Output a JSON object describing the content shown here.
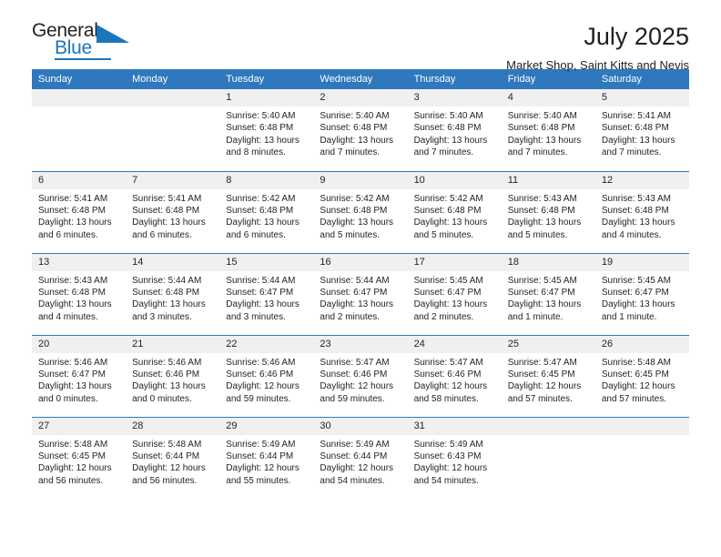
{
  "brand": {
    "name_part1": "General",
    "name_part2": "Blue",
    "accent_color": "#1b75bb"
  },
  "header": {
    "title": "July 2025",
    "subtitle": "Market Shop, Saint Kitts and Nevis"
  },
  "colors": {
    "header_blue": "#2f78bd",
    "daynum_band": "#f0f0f0",
    "text": "#231f20"
  },
  "weekdays": [
    "Sunday",
    "Monday",
    "Tuesday",
    "Wednesday",
    "Thursday",
    "Friday",
    "Saturday"
  ],
  "weeks": [
    [
      {
        "day": "",
        "sunrise": "",
        "sunset": "",
        "daylight": ""
      },
      {
        "day": "",
        "sunrise": "",
        "sunset": "",
        "daylight": ""
      },
      {
        "day": "1",
        "sunrise": "Sunrise: 5:40 AM",
        "sunset": "Sunset: 6:48 PM",
        "daylight": "Daylight: 13 hours and 8 minutes."
      },
      {
        "day": "2",
        "sunrise": "Sunrise: 5:40 AM",
        "sunset": "Sunset: 6:48 PM",
        "daylight": "Daylight: 13 hours and 7 minutes."
      },
      {
        "day": "3",
        "sunrise": "Sunrise: 5:40 AM",
        "sunset": "Sunset: 6:48 PM",
        "daylight": "Daylight: 13 hours and 7 minutes."
      },
      {
        "day": "4",
        "sunrise": "Sunrise: 5:40 AM",
        "sunset": "Sunset: 6:48 PM",
        "daylight": "Daylight: 13 hours and 7 minutes."
      },
      {
        "day": "5",
        "sunrise": "Sunrise: 5:41 AM",
        "sunset": "Sunset: 6:48 PM",
        "daylight": "Daylight: 13 hours and 7 minutes."
      }
    ],
    [
      {
        "day": "6",
        "sunrise": "Sunrise: 5:41 AM",
        "sunset": "Sunset: 6:48 PM",
        "daylight": "Daylight: 13 hours and 6 minutes."
      },
      {
        "day": "7",
        "sunrise": "Sunrise: 5:41 AM",
        "sunset": "Sunset: 6:48 PM",
        "daylight": "Daylight: 13 hours and 6 minutes."
      },
      {
        "day": "8",
        "sunrise": "Sunrise: 5:42 AM",
        "sunset": "Sunset: 6:48 PM",
        "daylight": "Daylight: 13 hours and 6 minutes."
      },
      {
        "day": "9",
        "sunrise": "Sunrise: 5:42 AM",
        "sunset": "Sunset: 6:48 PM",
        "daylight": "Daylight: 13 hours and 5 minutes."
      },
      {
        "day": "10",
        "sunrise": "Sunrise: 5:42 AM",
        "sunset": "Sunset: 6:48 PM",
        "daylight": "Daylight: 13 hours and 5 minutes."
      },
      {
        "day": "11",
        "sunrise": "Sunrise: 5:43 AM",
        "sunset": "Sunset: 6:48 PM",
        "daylight": "Daylight: 13 hours and 5 minutes."
      },
      {
        "day": "12",
        "sunrise": "Sunrise: 5:43 AM",
        "sunset": "Sunset: 6:48 PM",
        "daylight": "Daylight: 13 hours and 4 minutes."
      }
    ],
    [
      {
        "day": "13",
        "sunrise": "Sunrise: 5:43 AM",
        "sunset": "Sunset: 6:48 PM",
        "daylight": "Daylight: 13 hours and 4 minutes."
      },
      {
        "day": "14",
        "sunrise": "Sunrise: 5:44 AM",
        "sunset": "Sunset: 6:48 PM",
        "daylight": "Daylight: 13 hours and 3 minutes."
      },
      {
        "day": "15",
        "sunrise": "Sunrise: 5:44 AM",
        "sunset": "Sunset: 6:47 PM",
        "daylight": "Daylight: 13 hours and 3 minutes."
      },
      {
        "day": "16",
        "sunrise": "Sunrise: 5:44 AM",
        "sunset": "Sunset: 6:47 PM",
        "daylight": "Daylight: 13 hours and 2 minutes."
      },
      {
        "day": "17",
        "sunrise": "Sunrise: 5:45 AM",
        "sunset": "Sunset: 6:47 PM",
        "daylight": "Daylight: 13 hours and 2 minutes."
      },
      {
        "day": "18",
        "sunrise": "Sunrise: 5:45 AM",
        "sunset": "Sunset: 6:47 PM",
        "daylight": "Daylight: 13 hours and 1 minute."
      },
      {
        "day": "19",
        "sunrise": "Sunrise: 5:45 AM",
        "sunset": "Sunset: 6:47 PM",
        "daylight": "Daylight: 13 hours and 1 minute."
      }
    ],
    [
      {
        "day": "20",
        "sunrise": "Sunrise: 5:46 AM",
        "sunset": "Sunset: 6:47 PM",
        "daylight": "Daylight: 13 hours and 0 minutes."
      },
      {
        "day": "21",
        "sunrise": "Sunrise: 5:46 AM",
        "sunset": "Sunset: 6:46 PM",
        "daylight": "Daylight: 13 hours and 0 minutes."
      },
      {
        "day": "22",
        "sunrise": "Sunrise: 5:46 AM",
        "sunset": "Sunset: 6:46 PM",
        "daylight": "Daylight: 12 hours and 59 minutes."
      },
      {
        "day": "23",
        "sunrise": "Sunrise: 5:47 AM",
        "sunset": "Sunset: 6:46 PM",
        "daylight": "Daylight: 12 hours and 59 minutes."
      },
      {
        "day": "24",
        "sunrise": "Sunrise: 5:47 AM",
        "sunset": "Sunset: 6:46 PM",
        "daylight": "Daylight: 12 hours and 58 minutes."
      },
      {
        "day": "25",
        "sunrise": "Sunrise: 5:47 AM",
        "sunset": "Sunset: 6:45 PM",
        "daylight": "Daylight: 12 hours and 57 minutes."
      },
      {
        "day": "26",
        "sunrise": "Sunrise: 5:48 AM",
        "sunset": "Sunset: 6:45 PM",
        "daylight": "Daylight: 12 hours and 57 minutes."
      }
    ],
    [
      {
        "day": "27",
        "sunrise": "Sunrise: 5:48 AM",
        "sunset": "Sunset: 6:45 PM",
        "daylight": "Daylight: 12 hours and 56 minutes."
      },
      {
        "day": "28",
        "sunrise": "Sunrise: 5:48 AM",
        "sunset": "Sunset: 6:44 PM",
        "daylight": "Daylight: 12 hours and 56 minutes."
      },
      {
        "day": "29",
        "sunrise": "Sunrise: 5:49 AM",
        "sunset": "Sunset: 6:44 PM",
        "daylight": "Daylight: 12 hours and 55 minutes."
      },
      {
        "day": "30",
        "sunrise": "Sunrise: 5:49 AM",
        "sunset": "Sunset: 6:44 PM",
        "daylight": "Daylight: 12 hours and 54 minutes."
      },
      {
        "day": "31",
        "sunrise": "Sunrise: 5:49 AM",
        "sunset": "Sunset: 6:43 PM",
        "daylight": "Daylight: 12 hours and 54 minutes."
      },
      {
        "day": "",
        "sunrise": "",
        "sunset": "",
        "daylight": ""
      },
      {
        "day": "",
        "sunrise": "",
        "sunset": "",
        "daylight": ""
      }
    ]
  ]
}
